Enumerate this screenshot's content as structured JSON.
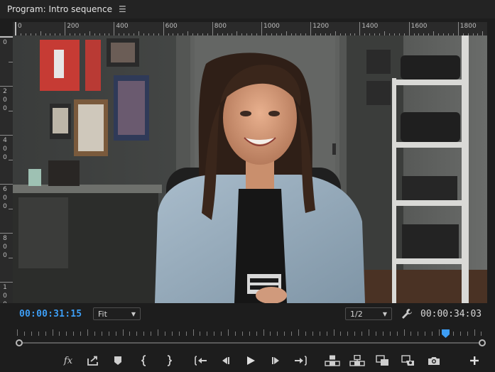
{
  "panel": {
    "title": "Program: Intro sequence",
    "menu_icon": "hamburger-icon"
  },
  "ruler": {
    "h_labels": [
      "0",
      "200",
      "400",
      "600",
      "800",
      "1000",
      "1200",
      "1400",
      "1600",
      "1800"
    ],
    "v_labels": [
      {
        "text": "0"
      },
      {
        "text": "200"
      },
      {
        "text": "400"
      },
      {
        "text": "600"
      },
      {
        "text": "800"
      },
      {
        "text": "100"
      }
    ]
  },
  "timebar": {
    "current_timecode": "00:00:31:15",
    "fit_label": "Fit",
    "resolution_label": "1/2",
    "duration_timecode": "00:00:34:03",
    "current_color": "#3d9ef5"
  },
  "transport": {
    "fx_label": "fx",
    "icons": [
      "fx-icon",
      "export-frame-icon",
      "add-marker-icon",
      "mark-in-icon",
      "mark-out-icon",
      "go-to-in-icon",
      "step-back-icon",
      "play-icon",
      "step-forward-icon",
      "go-to-out-icon",
      "insert-icon",
      "overwrite-icon",
      "comparison-view-icon",
      "vr-video-icon",
      "camera-icon",
      "add-button-icon"
    ]
  },
  "scrubber": {
    "playhead_position": 0.925
  },
  "colors": {
    "accent": "#3d9ef5",
    "panel_bg": "#1d1d1d"
  }
}
